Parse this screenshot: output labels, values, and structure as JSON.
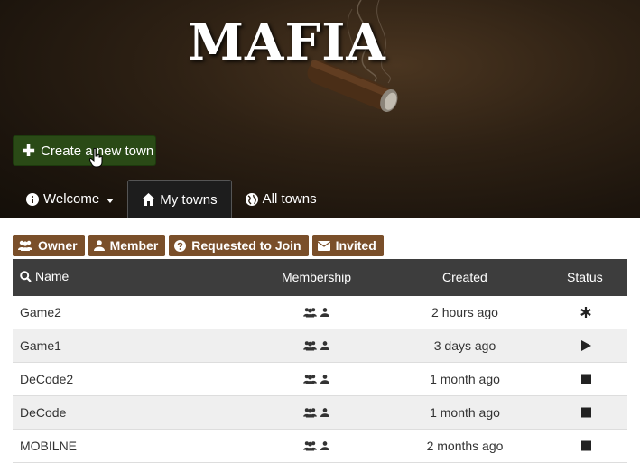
{
  "header": {
    "logo": "MAFIA",
    "create_button": "Create a new town",
    "nav": [
      {
        "label": "Welcome",
        "icon": "info-icon"
      },
      {
        "label": "My towns",
        "icon": "home-icon"
      },
      {
        "label": "All towns",
        "icon": "globe-icon"
      }
    ]
  },
  "filters": [
    {
      "label": "Owner",
      "icon": "users-icon"
    },
    {
      "label": "Member",
      "icon": "user-icon"
    },
    {
      "label": "Requested to Join",
      "icon": "question-icon"
    },
    {
      "label": "Invited",
      "icon": "envelope-icon"
    }
  ],
  "table": {
    "headers": {
      "name": "Name",
      "membership": "Membership",
      "created": "Created",
      "status": "Status"
    },
    "rows": [
      {
        "name": "Game2",
        "created": "2 hours ago",
        "status": "asterisk-icon"
      },
      {
        "name": "Game1",
        "created": "3 days ago",
        "status": "play-icon"
      },
      {
        "name": "DeCode2",
        "created": "1 month ago",
        "status": "stop-icon"
      },
      {
        "name": "DeCode",
        "created": "1 month ago",
        "status": "stop-icon"
      },
      {
        "name": "MOBILNE",
        "created": "2 months ago",
        "status": "stop-icon"
      }
    ]
  },
  "colors": {
    "header_bg": "#2a1e12",
    "create_button": "#2a4a16",
    "filter_button": "#7a4f2a",
    "table_header": "#3d3d3d",
    "row_alt": "#efefef"
  }
}
